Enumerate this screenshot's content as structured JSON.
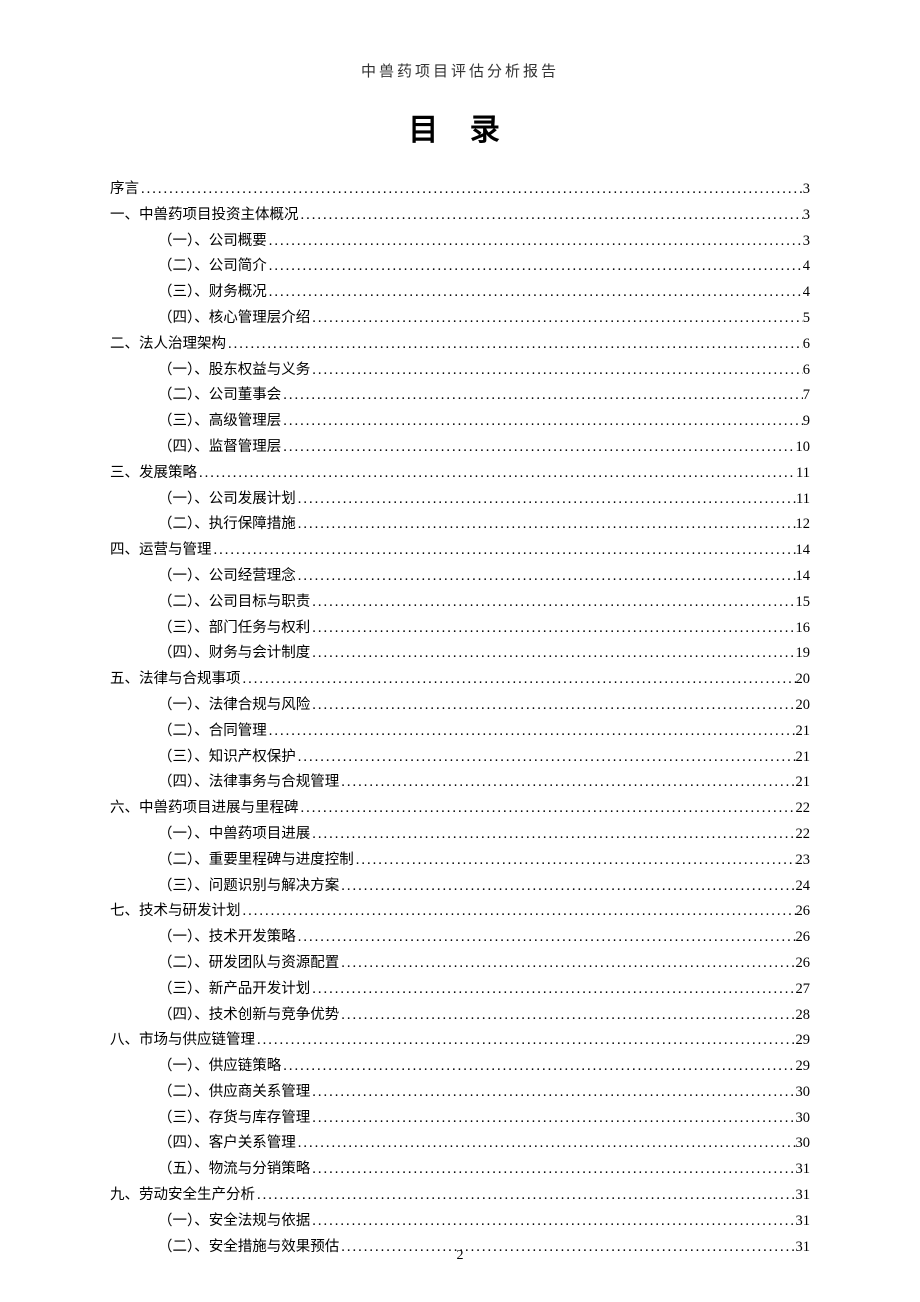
{
  "header": "中兽药项目评估分析报告",
  "title": "目 录",
  "page_number": "2",
  "toc": [
    {
      "level": 1,
      "label": "序言",
      "page": "3"
    },
    {
      "level": 1,
      "label": "一、中兽药项目投资主体概况",
      "page": "3"
    },
    {
      "level": 2,
      "label": "（一）、公司概要",
      "page": "3"
    },
    {
      "level": 2,
      "label": "（二）、公司简介",
      "page": "4"
    },
    {
      "level": 2,
      "label": "（三）、财务概况",
      "page": "4"
    },
    {
      "level": 2,
      "label": "（四）、核心管理层介绍",
      "page": "5"
    },
    {
      "level": 1,
      "label": "二、法人治理架构",
      "page": "6"
    },
    {
      "level": 2,
      "label": "（一）、股东权益与义务",
      "page": "6"
    },
    {
      "level": 2,
      "label": "（二）、公司董事会",
      "page": "7"
    },
    {
      "level": 2,
      "label": "（三）、高级管理层",
      "page": "9"
    },
    {
      "level": 2,
      "label": "（四）、监督管理层",
      "page": "10"
    },
    {
      "level": 1,
      "label": "三、发展策略",
      "page": "11"
    },
    {
      "level": 2,
      "label": "（一）、公司发展计划",
      "page": "11"
    },
    {
      "level": 2,
      "label": "（二）、执行保障措施",
      "page": "12"
    },
    {
      "level": 1,
      "label": "四、运营与管理",
      "page": "14"
    },
    {
      "level": 2,
      "label": "（一）、公司经营理念",
      "page": "14"
    },
    {
      "level": 2,
      "label": "（二）、公司目标与职责",
      "page": "15"
    },
    {
      "level": 2,
      "label": "（三）、部门任务与权利",
      "page": "16"
    },
    {
      "level": 2,
      "label": "（四）、财务与会计制度",
      "page": "19"
    },
    {
      "level": 1,
      "label": "五、法律与合规事项",
      "page": "20"
    },
    {
      "level": 2,
      "label": "（一）、法律合规与风险",
      "page": "20"
    },
    {
      "level": 2,
      "label": "（二）、合同管理",
      "page": "21"
    },
    {
      "level": 2,
      "label": "（三）、知识产权保护",
      "page": "21"
    },
    {
      "level": 2,
      "label": "（四）、法律事务与合规管理",
      "page": "21"
    },
    {
      "level": 1,
      "label": "六、中兽药项目进展与里程碑",
      "page": "22"
    },
    {
      "level": 2,
      "label": "（一）、中兽药项目进展",
      "page": "22"
    },
    {
      "level": 2,
      "label": "（二）、重要里程碑与进度控制",
      "page": "23"
    },
    {
      "level": 2,
      "label": "（三）、问题识别与解决方案",
      "page": "24"
    },
    {
      "level": 1,
      "label": "七、技术与研发计划",
      "page": "26"
    },
    {
      "level": 2,
      "label": "（一）、技术开发策略",
      "page": "26"
    },
    {
      "level": 2,
      "label": "（二）、研发团队与资源配置",
      "page": "26"
    },
    {
      "level": 2,
      "label": "（三）、新产品开发计划",
      "page": "27"
    },
    {
      "level": 2,
      "label": "（四）、技术创新与竞争优势",
      "page": "28"
    },
    {
      "level": 1,
      "label": "八、市场与供应链管理",
      "page": "29"
    },
    {
      "level": 2,
      "label": "（一）、供应链策略",
      "page": "29"
    },
    {
      "level": 2,
      "label": "（二）、供应商关系管理",
      "page": "30"
    },
    {
      "level": 2,
      "label": "（三）、存货与库存管理",
      "page": "30"
    },
    {
      "level": 2,
      "label": "（四）、客户关系管理",
      "page": "30"
    },
    {
      "level": 2,
      "label": "（五）、物流与分销策略",
      "page": "31"
    },
    {
      "level": 1,
      "label": "九、劳动安全生产分析",
      "page": "31"
    },
    {
      "level": 2,
      "label": "（一）、安全法规与依据",
      "page": "31"
    },
    {
      "level": 2,
      "label": "（二）、安全措施与效果预估",
      "page": "31"
    }
  ]
}
